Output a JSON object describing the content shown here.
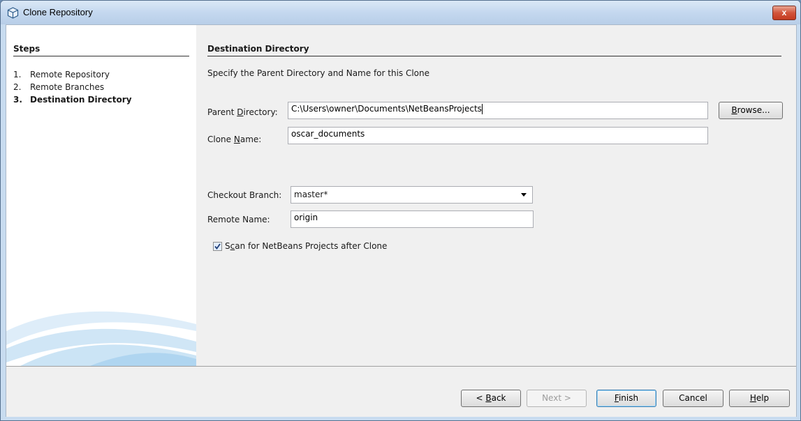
{
  "window": {
    "title": "Clone Repository",
    "close_label": "x"
  },
  "steps": {
    "header": "Steps",
    "items": [
      {
        "num": "1.",
        "label": "Remote Repository"
      },
      {
        "num": "2.",
        "label": "Remote Branches"
      },
      {
        "num": "3.",
        "label": "Destination Directory"
      }
    ],
    "current_index": 2
  },
  "panel": {
    "title": "Destination Directory",
    "description": "Specify the Parent Directory and Name for this Clone",
    "parent_directory": {
      "label_pre": "Parent ",
      "label_mnemonic": "D",
      "label_post": "irectory:",
      "value": "C:\\Users\\owner\\Documents\\NetBeansProjects"
    },
    "browse": {
      "mnemonic": "B",
      "rest": "rowse..."
    },
    "clone_name": {
      "label_pre": "Clone ",
      "label_mnemonic": "N",
      "label_post": "ame:",
      "value": "oscar_documents"
    },
    "checkout_branch": {
      "label": "Checkout Branch:",
      "value": "master*"
    },
    "remote_name": {
      "label": "Remote Name:",
      "value": "origin"
    },
    "scan_checkbox": {
      "checked": true,
      "label_pre": "S",
      "label_mnemonic": "c",
      "label_post": "an for NetBeans Projects after Clone"
    }
  },
  "buttons": {
    "back": {
      "pre": "< ",
      "mnemonic": "B",
      "post": "ack"
    },
    "next": {
      "label": "Next >"
    },
    "finish": {
      "mnemonic": "F",
      "post": "inish"
    },
    "cancel": {
      "label": "Cancel"
    },
    "help": {
      "mnemonic": "H",
      "post": "elp"
    }
  },
  "colors": {
    "title_gradient_top": "#dbe8f6",
    "close_red": "#c43b20",
    "dialog_bg": "#f0f0f0",
    "accent": "#3c7fb1"
  }
}
